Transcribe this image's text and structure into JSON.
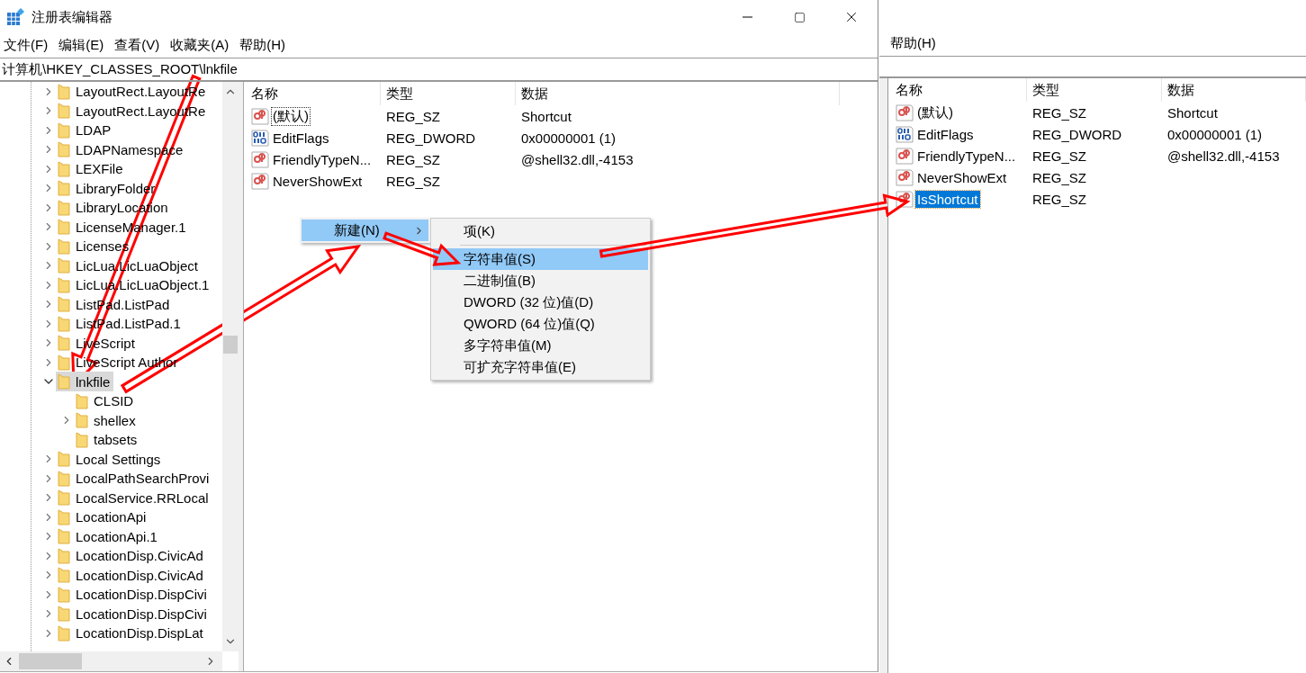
{
  "window": {
    "title": "注册表编辑器"
  },
  "menu": [
    "文件(F)",
    "编辑(E)",
    "查看(V)",
    "收藏夹(A)",
    "帮助(H)"
  ],
  "address": "计算机\\HKEY_CLASSES_ROOT\\lnkfile",
  "tree": [
    {
      "label": "LayoutRect.LayoutRe",
      "expandable": true,
      "expanded": false,
      "selected": false
    },
    {
      "label": "LayoutRect.LayoutRe",
      "expandable": true,
      "expanded": false,
      "selected": false
    },
    {
      "label": "LDAP",
      "expandable": true,
      "expanded": false,
      "selected": false
    },
    {
      "label": "LDAPNamespace",
      "expandable": true,
      "expanded": false,
      "selected": false
    },
    {
      "label": "LEXFile",
      "expandable": true,
      "expanded": false,
      "selected": false
    },
    {
      "label": "LibraryFolder",
      "expandable": true,
      "expanded": false,
      "selected": false
    },
    {
      "label": "LibraryLocation",
      "expandable": true,
      "expanded": false,
      "selected": false
    },
    {
      "label": "LicenseManager.1",
      "expandable": true,
      "expanded": false,
      "selected": false
    },
    {
      "label": "Licenses",
      "expandable": true,
      "expanded": false,
      "selected": false
    },
    {
      "label": "LicLua.LicLuaObject",
      "expandable": true,
      "expanded": false,
      "selected": false
    },
    {
      "label": "LicLua.LicLuaObject.1",
      "expandable": true,
      "expanded": false,
      "selected": false
    },
    {
      "label": "ListPad.ListPad",
      "expandable": true,
      "expanded": false,
      "selected": false
    },
    {
      "label": "ListPad.ListPad.1",
      "expandable": true,
      "expanded": false,
      "selected": false
    },
    {
      "label": "LiveScript",
      "expandable": true,
      "expanded": false,
      "selected": false
    },
    {
      "label": "LiveScript Author",
      "expandable": true,
      "expanded": false,
      "selected": false
    },
    {
      "label": "lnkfile",
      "expandable": true,
      "expanded": true,
      "selected": true,
      "children": [
        {
          "label": "CLSID",
          "expandable": false,
          "selected": false
        },
        {
          "label": "shellex",
          "expandable": true,
          "expanded": false,
          "selected": false
        },
        {
          "label": "tabsets",
          "expandable": false,
          "selected": false
        }
      ]
    },
    {
      "label": "Local Settings",
      "expandable": true,
      "expanded": false,
      "selected": false
    },
    {
      "label": "LocalPathSearchProvi",
      "expandable": true,
      "expanded": false,
      "selected": false
    },
    {
      "label": "LocalService.RRLocal",
      "expandable": true,
      "expanded": false,
      "selected": false
    },
    {
      "label": "LocationApi",
      "expandable": true,
      "expanded": false,
      "selected": false
    },
    {
      "label": "LocationApi.1",
      "expandable": true,
      "expanded": false,
      "selected": false
    },
    {
      "label": "LocationDisp.CivicAd",
      "expandable": true,
      "expanded": false,
      "selected": false
    },
    {
      "label": "LocationDisp.CivicAd",
      "expandable": true,
      "expanded": false,
      "selected": false
    },
    {
      "label": "LocationDisp.DispCivi",
      "expandable": true,
      "expanded": false,
      "selected": false
    },
    {
      "label": "LocationDisp.DispCivi",
      "expandable": true,
      "expanded": false,
      "selected": false
    },
    {
      "label": "LocationDisp.DispLat",
      "expandable": true,
      "expanded": false,
      "selected": false
    }
  ],
  "values": {
    "columns": [
      "名称",
      "类型",
      "数据"
    ],
    "rows": [
      {
        "kind": "string",
        "name": "(默认)",
        "type": "REG_SZ",
        "data": "Shortcut",
        "focused": true
      },
      {
        "kind": "binary",
        "name": "EditFlags",
        "type": "REG_DWORD",
        "data": "0x00000001 (1)",
        "focused": false
      },
      {
        "kind": "string",
        "name": "FriendlyTypeN...",
        "type": "REG_SZ",
        "data": "@shell32.dll,-4153",
        "focused": false
      },
      {
        "kind": "string",
        "name": "NeverShowExt",
        "type": "REG_SZ",
        "focused": false
      }
    ]
  },
  "context_menu": {
    "items": [
      {
        "label": "新建(N)",
        "selected": true,
        "submenu": true
      }
    ],
    "submenu": [
      {
        "kind": "item",
        "label": "项(K)",
        "selected": false
      },
      {
        "kind": "separator"
      },
      {
        "kind": "item",
        "label": "字符串值(S)",
        "selected": true
      },
      {
        "kind": "item",
        "label": "二进制值(B)",
        "selected": false
      },
      {
        "kind": "item",
        "label": "DWORD (32 位)值(D)",
        "selected": false
      },
      {
        "kind": "item",
        "label": "QWORD (64 位)值(Q)",
        "selected": false
      },
      {
        "kind": "item",
        "label": "多字符串值(M)",
        "selected": false
      },
      {
        "kind": "item",
        "label": "可扩充字符串值(E)",
        "selected": false
      }
    ]
  },
  "result": {
    "menu": [
      "帮助(H)"
    ],
    "columns": [
      "名称",
      "类型",
      "数据"
    ],
    "rows": [
      {
        "kind": "string",
        "name": "(默认)",
        "type": "REG_SZ",
        "data": "Shortcut",
        "selected": false
      },
      {
        "kind": "binary",
        "name": "EditFlags",
        "type": "REG_DWORD",
        "data": "0x00000001 (1)",
        "selected": false
      },
      {
        "kind": "string",
        "name": "FriendlyTypeN...",
        "type": "REG_SZ",
        "data": "@shell32.dll,-4153",
        "selected": false
      },
      {
        "kind": "string",
        "name": "NeverShowExt",
        "type": "REG_SZ",
        "selected": false
      },
      {
        "kind": "string",
        "name": "IsShortcut",
        "type": "REG_SZ",
        "selected": true
      }
    ]
  }
}
